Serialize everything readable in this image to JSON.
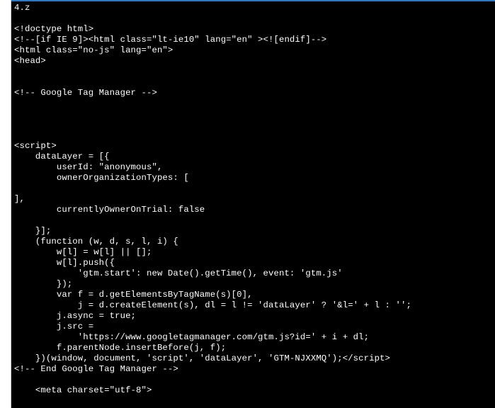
{
  "accent_color": "#2a7acc",
  "bg_color": "#000000",
  "fg_color": "#ffffff",
  "lines": [
    "4.z",
    "",
    "<!doctype html>",
    "<!--[if IE 9]><html class=\"lt-ie10\" lang=\"en\" ><![endif]-->",
    "<html class=\"no-js\" lang=\"en\">",
    "<head>",
    "",
    "",
    "<!-- Google Tag Manager -->",
    "",
    "",
    "",
    "",
    "<script>",
    "    dataLayer = [{",
    "        userId: \"anonymous\",",
    "        ownerOrganizationTypes: [",
    "",
    "],",
    "        currentlyOwnerOnTrial: false",
    "",
    "    }];",
    "    (function (w, d, s, l, i) {",
    "        w[l] = w[l] || [];",
    "        w[l].push({",
    "            'gtm.start': new Date().getTime(), event: 'gtm.js'",
    "        });",
    "        var f = d.getElementsByTagName(s)[0],",
    "            j = d.createElement(s), dl = l != 'dataLayer' ? '&l=' + l : '';",
    "        j.async = true;",
    "        j.src =",
    "            'https://www.googletagmanager.com/gtm.js?id=' + i + dl;",
    "        f.parentNode.insertBefore(j, f);",
    "    })(window, document, 'script', 'dataLayer', 'GTM-NJXXMQ');</script>",
    "<!-- End Google Tag Manager -->",
    "",
    "    <meta charset=\"utf-8\">"
  ]
}
